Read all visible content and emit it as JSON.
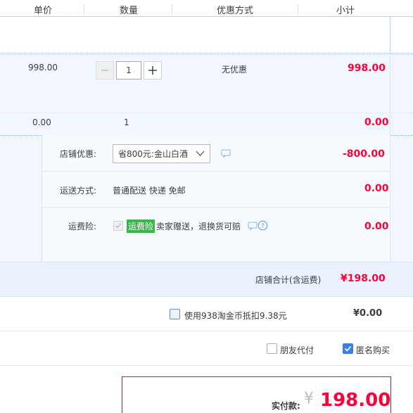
{
  "header": {
    "unit_price": "单价",
    "quantity": "数量",
    "discount_method": "优惠方式",
    "subtotal": "小计"
  },
  "item": {
    "price": "998.00",
    "quantity": "1",
    "discount": "无优惠",
    "subtotal": "998.00"
  },
  "extra_row": {
    "price": "0.00",
    "quantity": "1",
    "subtotal": "0.00"
  },
  "shop_discount": {
    "label": "店铺优惠:",
    "selected": "省800元:金山白酒",
    "amount": "-800.00"
  },
  "shipping": {
    "label": "运送方式:",
    "value": "普通配送 快递 免邮",
    "amount": "0.00"
  },
  "insurance": {
    "label": "运费险:",
    "badge": "运费险",
    "text": "卖家赠送，退换货可赔",
    "amount": "0.00"
  },
  "shop_total": {
    "label": "店铺合计(含运费)",
    "amount": "¥198.00"
  },
  "coins": {
    "text": "使用938淘金币抵扣9.38元",
    "amount": "¥0.00"
  },
  "options": {
    "friend_pay": "朋友代付",
    "anonymous": "匿名购买"
  },
  "payment": {
    "label": "实付款:",
    "currency": "¥",
    "amount": "198.00"
  },
  "colors": {
    "accent_red": "#ff0036",
    "light_blue_bg": "#f2f7ff",
    "border_blue": "#b2d1ff",
    "badge_green": "#3ab54a",
    "check_blue": "#3a7ee5"
  }
}
